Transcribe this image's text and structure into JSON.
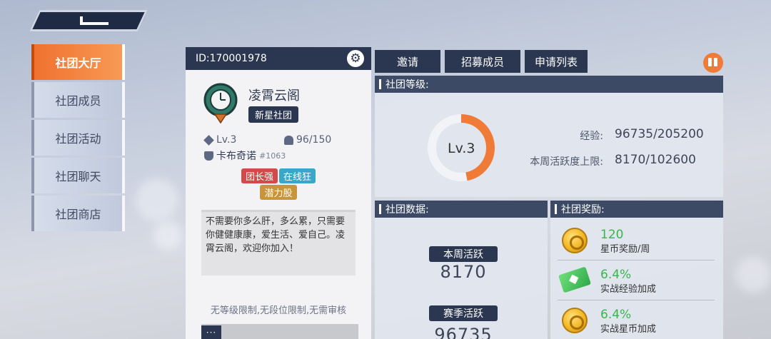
{
  "nav": {
    "items": [
      {
        "label": "社团大厅",
        "active": true
      },
      {
        "label": "社团成员",
        "active": false
      },
      {
        "label": "社团活动",
        "active": false
      },
      {
        "label": "社团聊天",
        "active": false
      },
      {
        "label": "社团商店",
        "active": false
      }
    ]
  },
  "club": {
    "id_label": "ID:170001978",
    "name": "凌霄云阁",
    "rank_badge": "新星社团",
    "level": "Lv.3",
    "members": "96/150",
    "leader_name": "卡布奇诺",
    "leader_tag": "#1063",
    "tags": [
      {
        "label": "团长强",
        "color": "#d24a4a"
      },
      {
        "label": "在线狂",
        "color": "#3aa6c8"
      },
      {
        "label": "潜力股",
        "color": "#c9953a"
      }
    ],
    "description": "不需要你多么肝，多么累，只需要你健健康康，爱生活、爱自己。凌霄云阁，欢迎你加入！",
    "limits": "无等级限制,无段位限制,无需审核",
    "chat_button": "···"
  },
  "tabs": [
    "邀请",
    "招募成员",
    "申请列表"
  ],
  "level_section": {
    "title": "社团等级:",
    "ring_label": "Lv.3",
    "exp_label": "经验:",
    "exp_value": "96735/205200",
    "exp_progress": 0.47,
    "weekly_cap_label": "本周活跃度上限:",
    "weekly_cap_value": "8170/102600"
  },
  "data_section": {
    "title": "社团数据:",
    "weekly_label": "本周活跃",
    "weekly_value": "8170",
    "season_label": "赛季活跃",
    "season_value": "96735"
  },
  "rewards_section": {
    "title": "社团奖励:",
    "items": [
      {
        "value": "120",
        "label": "星币奖励/周",
        "icon": "coin-icon"
      },
      {
        "value": "6.4%",
        "label": "实战经验加成",
        "icon": "ticket-icon"
      },
      {
        "value": "6.4%",
        "label": "实战星币加成",
        "icon": "coin-icon"
      }
    ]
  },
  "colors": {
    "accent": "#f07a38",
    "dark": "#2b3650",
    "reward_green": "#39b54a"
  }
}
